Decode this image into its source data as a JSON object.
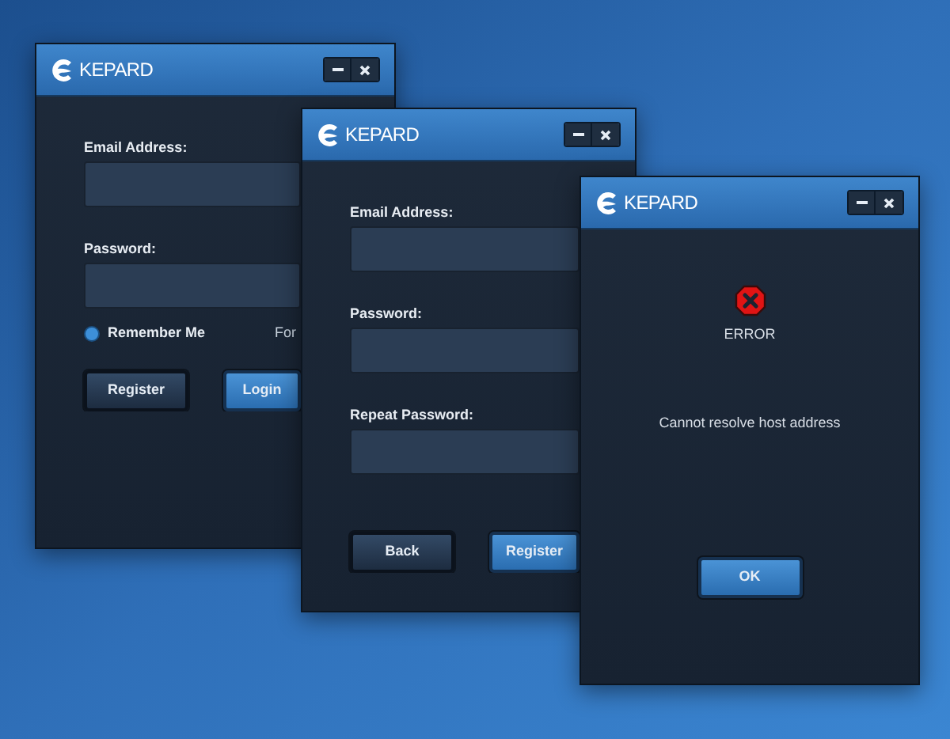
{
  "windows": [
    {
      "kind": "form",
      "title": "KEPARD",
      "items": [
        {
          "kind": "field",
          "label": "Email Address:"
        },
        {
          "kind": "field",
          "label": "Password:"
        },
        {
          "kind": "check",
          "label": "Remember Me",
          "checked": true,
          "link": "For"
        },
        {
          "kind": "buttons",
          "buttons": [
            {
              "label": "Register",
              "primary": false
            },
            {
              "label": "Login",
              "primary": true
            }
          ]
        }
      ]
    },
    {
      "kind": "form",
      "title": "KEPARD",
      "items": [
        {
          "kind": "field",
          "label": "Email Address:"
        },
        {
          "kind": "field",
          "label": "Password:"
        },
        {
          "kind": "field",
          "label": "Repeat Password:"
        },
        {
          "kind": "buttons",
          "buttons": [
            {
              "label": "Back",
              "primary": false
            },
            {
              "label": "Register",
              "primary": true
            }
          ]
        }
      ]
    },
    {
      "kind": "dialog",
      "title": "KEPARD",
      "items": [
        {
          "kind": "error",
          "label": "ERROR"
        },
        {
          "kind": "message",
          "text": "Cannot resolve host address"
        },
        {
          "kind": "buttons",
          "buttons": [
            {
              "label": "OK",
              "primary": true
            }
          ]
        }
      ]
    }
  ]
}
